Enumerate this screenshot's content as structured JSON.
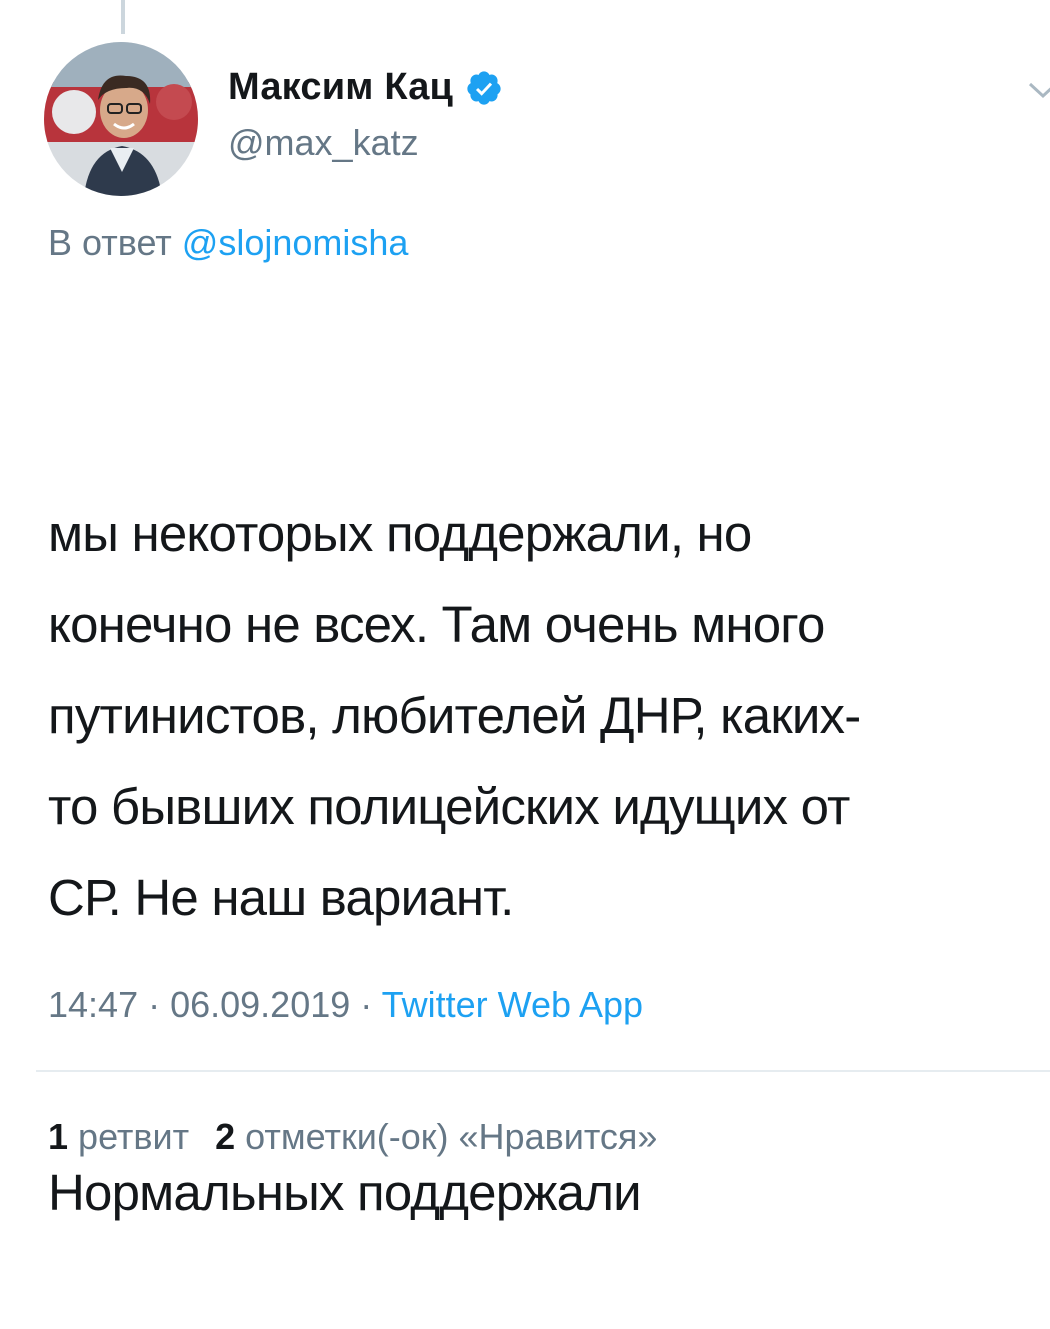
{
  "user": {
    "display_name": "Максим Кац",
    "handle": "@max_katz",
    "verified_icon": "verified-badge-icon"
  },
  "reply": {
    "prefix": "В ответ ",
    "mention": "@slojnomisha"
  },
  "tweet": {
    "paragraphs": [
      "мы некоторых поддержали, но\nконечно не всех. Там очень много\nпутинистов, любителей ДНР, каких-\nто бывших полицейских идущих от\nСР. Не наш вариант.",
      "Нормальных поддержали"
    ]
  },
  "meta": {
    "time": "14:47",
    "separator": " · ",
    "date": "06.09.2019",
    "source": "Twitter Web App"
  },
  "stats": {
    "retweets_count": "1",
    "retweets_label": "ретвит",
    "likes_count": "2",
    "likes_label": "отметки(-ок) «Нравится»"
  },
  "colors": {
    "link": "#1da1f2",
    "secondary_text": "#657786",
    "primary_text": "#14171a"
  }
}
